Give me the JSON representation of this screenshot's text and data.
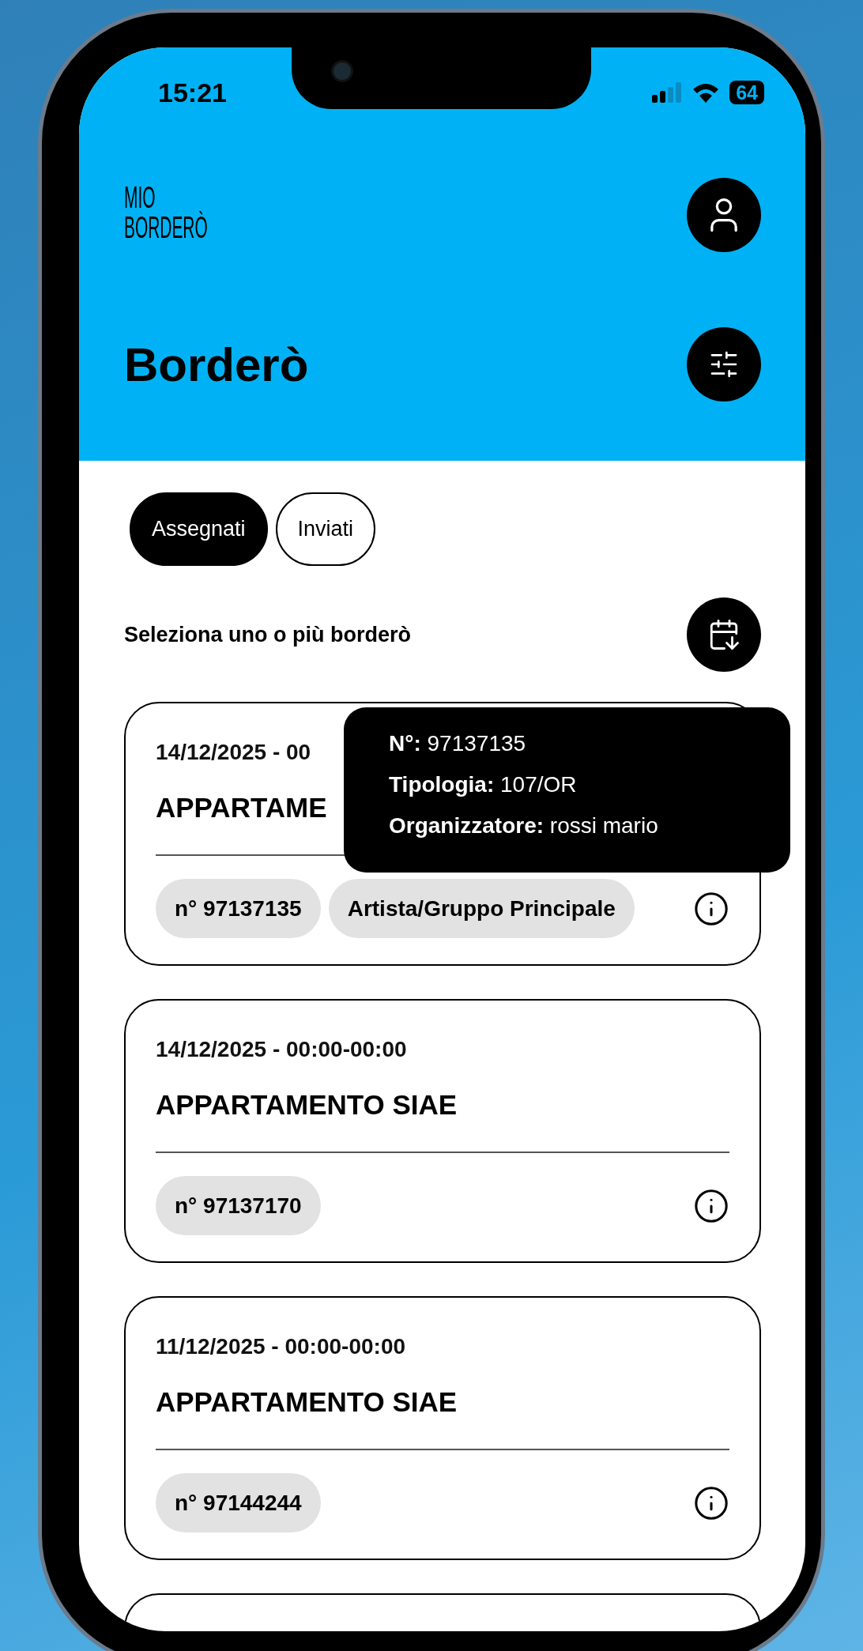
{
  "status_bar": {
    "time": "15:21",
    "battery": "64"
  },
  "header": {
    "logo": {
      "line_1": "MIO",
      "line_2": "BORDERÒ"
    },
    "title": "Borderò"
  },
  "tabs": [
    {
      "label": "Assegnati",
      "selected": true
    },
    {
      "label": "Inviati",
      "selected": false
    }
  ],
  "instruction": "Seleziona uno o più borderò",
  "cards": [
    {
      "date": "14/12/2025 - 00",
      "title": "APPARTAME",
      "chips": [
        "n° 97137135",
        "Artista/Gruppo Principale"
      ]
    },
    {
      "date": "14/12/2025 - 00:00-00:00",
      "title": "APPARTAMENTO SIAE",
      "chips": [
        "n° 97137170"
      ]
    },
    {
      "date": "11/12/2025 - 00:00-00:00",
      "title": "APPARTAMENTO SIAE",
      "chips": [
        "n° 97144244"
      ]
    }
  ],
  "tooltip": {
    "lines": [
      "**N°:** 97137135",
      "**Tipologia:** 107/OR",
      "**Organizzatore:** rossi mario"
    ]
  }
}
